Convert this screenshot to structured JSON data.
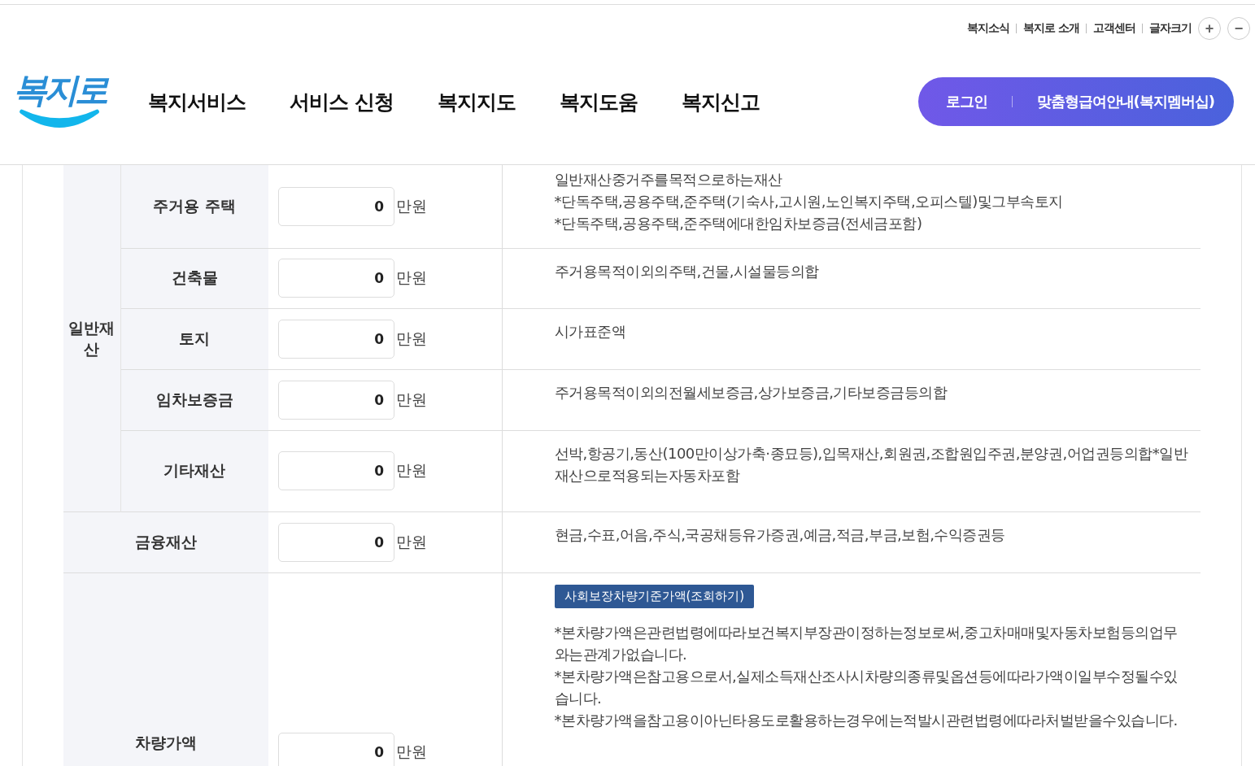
{
  "header": {
    "logo": "복지로",
    "top_links": [
      "복지소식",
      "복지로 소개",
      "고객센터"
    ],
    "font_size": {
      "label": "글자크기",
      "buttons": [
        "+",
        "−"
      ]
    },
    "nav": [
      "복지서비스",
      "서비스 신청",
      "복지지도",
      "복지도움",
      "복지신고"
    ],
    "login": "로그인",
    "membership": "맞춤형급여안내(복지멤버십)"
  },
  "general_property": {
    "label": "일반재산",
    "items": [
      {
        "label": "주거용 주택",
        "value": "0",
        "unit": "만원",
        "description": [
          "일반재산중거주를목적으로하는재산",
          "*단독주택,공용주택,준주택(기숙사,고시원,노인복지주택,오피스텔)및그부속토지",
          "*단독주택,공용주택,준주택에대한임차보증금(전세금포함)"
        ]
      },
      {
        "label": "건축물",
        "value": "0",
        "unit": "만원",
        "description": [
          "주거용목적이외의주택,건물,시설물등의합"
        ]
      },
      {
        "label": "토지",
        "value": "0",
        "unit": "만원",
        "description": [
          "시가표준액"
        ]
      },
      {
        "label": "임차보증금",
        "value": "0",
        "unit": "만원",
        "description": [
          "주거용목적이외의전월세보증금,상가보증금,기타보증금등의합"
        ]
      },
      {
        "label": "기타재산",
        "value": "0",
        "unit": "만원",
        "description": [
          "선박,항공기,동산(100만이상가축·종묘등),입목재산,회원권,조합원입주권,분양권,어업권등의합*일반재산으로적용되는자동차포함"
        ]
      }
    ]
  },
  "other_rows": [
    {
      "label": "금융재산",
      "value": "0",
      "unit": "만원",
      "description": [
        "현금,수표,어음,주식,국공채등유가증권,예금,적금,부금,보험,수익증권등"
      ]
    },
    {
      "label": "차량가액",
      "value": "0",
      "unit": "만원",
      "button": "사회보장차량기준가액(조회하기)",
      "description": [
        "*본차량가액은관련법령에따라보건복지부장관이정하는정보로써,중고차매매및자동차보험등의업무와는관계가없습니다.",
        "*본차량가액은참고용으로서,실제소득재산조사시차량의종류및옵션등에따라가액이일부수정될수있습니다.",
        "*본차량가액을참고용이아닌타용도로활용하는경우에는적발시관련법령에따라처벌받을수있습니다."
      ]
    }
  ]
}
